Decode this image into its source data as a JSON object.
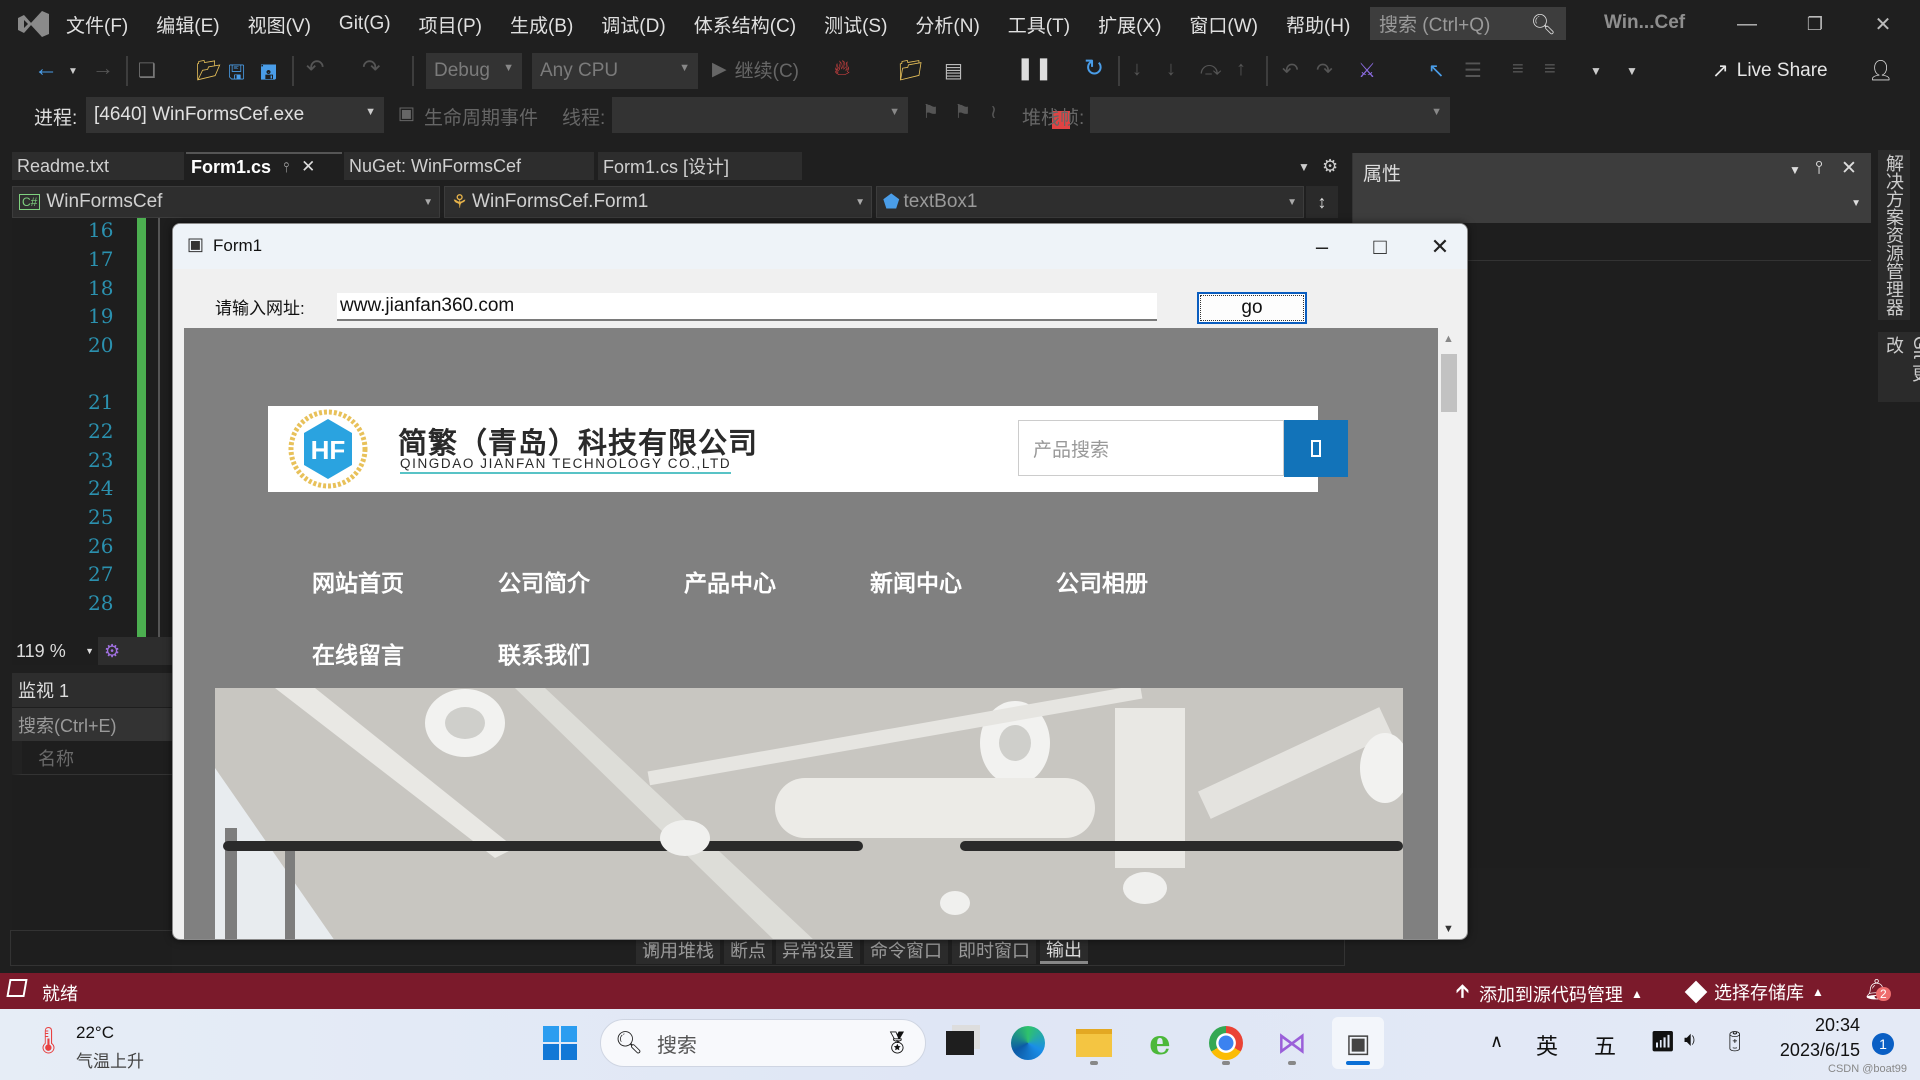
{
  "menubar": {
    "items": [
      "文件(F)",
      "编辑(E)",
      "视图(V)",
      "Git(G)",
      "项目(P)",
      "生成(B)",
      "调试(D)",
      "体系结构(C)",
      "测试(S)",
      "分析(N)",
      "工具(T)",
      "扩展(X)",
      "窗口(W)",
      "帮助(H)"
    ],
    "search_placeholder": "搜索 (Ctrl+Q)",
    "window_title": "Win...Cef"
  },
  "toolbar": {
    "config": "Debug",
    "platform": "Any CPU",
    "continue_label": "继续(C)",
    "live_share": "Live Share"
  },
  "debugbar": {
    "process_label": "进程:",
    "process_value": "[4640] WinFormsCef.exe",
    "lifecycle_label": "生命周期事件",
    "thread_label": "线程:",
    "thread_value": "",
    "stackframe_label": "堆栈帧:",
    "stackframe_value": ""
  },
  "doc_tabs": [
    {
      "label": "Readme.txt",
      "active": false
    },
    {
      "label": "Form1.cs",
      "active": true
    },
    {
      "label": "NuGet: WinFormsCef",
      "active": false
    },
    {
      "label": "Form1.cs [设计]",
      "active": false
    }
  ],
  "nav": {
    "project": "WinFormsCef",
    "class": "WinFormsCef.Form1",
    "member": "textBox1"
  },
  "editor": {
    "line_numbers": [
      "16",
      "17",
      "18",
      "19",
      "20",
      "21",
      "22",
      "23",
      "24",
      "25",
      "26",
      "27",
      "28"
    ],
    "zoom": "119 %"
  },
  "watch": {
    "title": "监视 1",
    "search_placeholder": "搜索(Ctrl+E)",
    "col_name": "名称"
  },
  "form1": {
    "title": "Form1",
    "url_label": "请输入网址:",
    "url_value": "www.jianfan360.com",
    "go_label": "go",
    "site": {
      "company_cn": "简繁（青岛）科技有限公司",
      "company_en": "QINGDAO JIANFAN TECHNOLOGY CO.,LTD",
      "search_placeholder": "产品搜索",
      "nav": [
        "网站首页",
        "公司简介",
        "产品中心",
        "新闻中心",
        "公司相册",
        "在线留言",
        "联系我们"
      ]
    }
  },
  "bottom_tabs": [
    "调用堆栈",
    "断点",
    "异常设置",
    "命令窗口",
    "即时窗口",
    "输出"
  ],
  "properties": {
    "title": "属性"
  },
  "side_tabs": [
    "解决方案资源管理器",
    "Git 更改"
  ],
  "statusbar": {
    "status": "就绪",
    "add_source": "添加到源代码管理",
    "select_repo": "选择存储库",
    "notifications": "2",
    "color": "#7b1a2b"
  },
  "taskbar": {
    "weather_temp": "22°C",
    "weather_desc": "气温上升",
    "search_label": "搜索",
    "ime_lang": "英",
    "ime_mode": "五",
    "time": "20:34",
    "date": "2023/6/15",
    "notif_count": "1",
    "watermark": "CSDN @boat99"
  }
}
